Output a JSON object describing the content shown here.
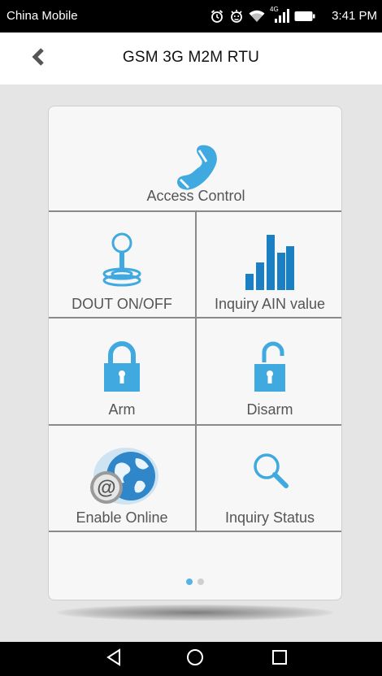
{
  "status_bar": {
    "carrier": "China Mobile",
    "network": "4G",
    "time": "3:41 PM"
  },
  "header": {
    "title": "GSM 3G M2M RTU",
    "back_icon": "chevron-left-icon"
  },
  "tiles": [
    {
      "id": "access-control",
      "label": "Access Control",
      "icon": "phone-icon"
    },
    {
      "id": "dout-onoff",
      "label": "DOUT ON/OFF",
      "icon": "joystick-icon"
    },
    {
      "id": "inquiry-ain",
      "label": "Inquiry AIN value",
      "icon": "bar-chart-icon"
    },
    {
      "id": "arm",
      "label": "Arm",
      "icon": "lock-closed-icon"
    },
    {
      "id": "disarm",
      "label": "Disarm",
      "icon": "lock-open-icon"
    },
    {
      "id": "enable-online",
      "label": "Enable Online",
      "icon": "globe-at-icon"
    },
    {
      "id": "inquiry-status",
      "label": "Inquiry Status",
      "icon": "search-icon"
    }
  ],
  "pager": {
    "pages": 2,
    "active": 1
  },
  "colors": {
    "accent": "#3fa9e0",
    "divider": "#8a8a8a",
    "card_bg": "#f7f7f7",
    "page_bg": "#e5e5e5"
  },
  "nav_bar": {
    "icons": [
      "back-triangle-icon",
      "home-circle-icon",
      "recents-square-icon"
    ]
  }
}
